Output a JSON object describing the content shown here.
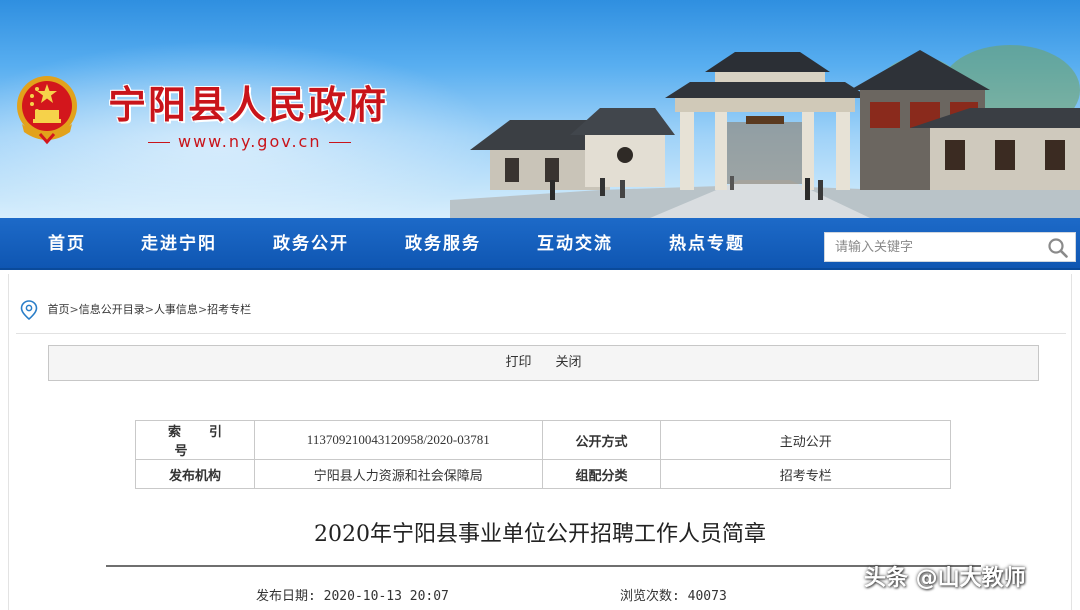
{
  "header": {
    "site_title": "宁阳县人民政府",
    "site_url": "www.ny.gov.cn"
  },
  "nav": {
    "items": [
      "首页",
      "走进宁阳",
      "政务公开",
      "政务服务",
      "互动交流",
      "热点专题"
    ],
    "search_placeholder": "请输入关键字"
  },
  "breadcrumb": {
    "items": [
      "首页",
      "信息公开目录",
      "人事信息",
      "招考专栏"
    ],
    "separator": ">"
  },
  "actions": {
    "print": "打印",
    "close": "关闭"
  },
  "meta": {
    "index_label": "索引号",
    "index_value": "113709210043120958/2020-03781",
    "method_label": "公开方式",
    "method_value": "主动公开",
    "publisher_label": "发布机构",
    "publisher_value": "宁阳县人力资源和社会保障局",
    "category_label": "组配分类",
    "category_value": "招考专栏"
  },
  "article": {
    "title": "2020年宁阳县事业单位公开招聘工作人员简章",
    "publish_label": "发布日期:",
    "publish_date": "2020-10-13 20:07",
    "views_label": "浏览次数:",
    "views": "40073"
  },
  "watermark": "头条 @山大教师",
  "colors": {
    "title_red": "#c9141a",
    "nav_blue": "#1460be",
    "banner_sky": "#58aef0"
  }
}
